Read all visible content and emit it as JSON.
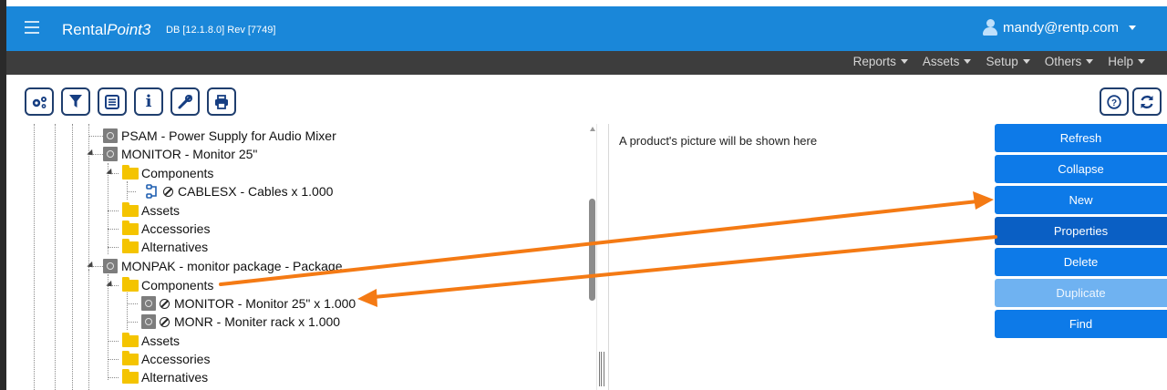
{
  "app": {
    "brand_main": "Rental",
    "brand_italic": "Point3",
    "version": "DB [12.1.8.0]  Rev [7749]",
    "user": "mandy@rentp.com"
  },
  "menu": {
    "items": [
      "Reports",
      "Assets",
      "Setup",
      "Others",
      "Help"
    ]
  },
  "toolbar": {
    "left_buttons": [
      "settings-gears-icon",
      "filter-icon",
      "list-icon",
      "info-icon",
      "tools-icon",
      "print-icon"
    ],
    "right_buttons": [
      "help-circle-icon",
      "refresh-icon"
    ],
    "info_glyph": "i"
  },
  "tree": {
    "rows": [
      {
        "text": "PSAM - Power Supply for Audio Mixer",
        "icon": "product-icon"
      },
      {
        "text": "MONITOR - Monitor 25\"",
        "icon": "product-icon"
      },
      {
        "text": "Components",
        "icon": "folder-icon"
      },
      {
        "text": "CABLESX - Cables x 1.000",
        "icon": "cable-icon"
      },
      {
        "text": "Assets",
        "icon": "folder-icon"
      },
      {
        "text": "Accessories",
        "icon": "folder-icon"
      },
      {
        "text": "Alternatives",
        "icon": "folder-icon"
      },
      {
        "text": "MONPAK - monitor package - Package",
        "icon": "product-icon"
      },
      {
        "text": "Components",
        "icon": "folder-icon"
      },
      {
        "text": "MONITOR - Monitor 25\" x 1.000",
        "icon": "product-icon"
      },
      {
        "text": "MONR - Moniter rack x 1.000",
        "icon": "product-icon"
      },
      {
        "text": "Assets",
        "icon": "folder-icon"
      },
      {
        "text": "Accessories",
        "icon": "folder-icon"
      },
      {
        "text": "Alternatives",
        "icon": "folder-icon"
      }
    ]
  },
  "picture": {
    "placeholder": "A product's picture will be shown here"
  },
  "actions": {
    "refresh": "Refresh",
    "collapse": "Collapse",
    "new": "New",
    "properties": "Properties",
    "delete": "Delete",
    "duplicate": "Duplicate",
    "find": "Find"
  },
  "colors": {
    "topbar": "#1a87d9",
    "menubar": "#3d3d3d",
    "button": "#0d7ae8",
    "button_disabled": "#6fb2f1",
    "annotation_arrow": "#f47a14"
  }
}
